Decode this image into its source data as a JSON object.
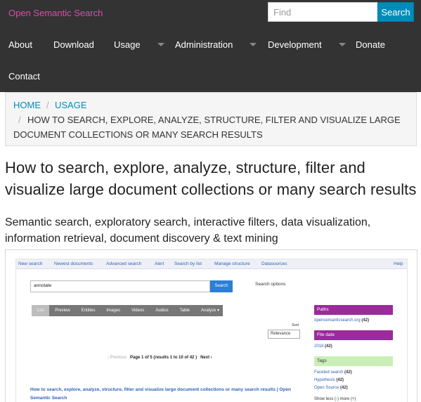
{
  "header": {
    "brand": "Open Semantic Search",
    "search_placeholder": "Find",
    "search_button": "Search"
  },
  "nav": {
    "items": [
      {
        "label": "About"
      },
      {
        "label": "Download"
      },
      {
        "label": "Usage",
        "dropdown": true
      },
      {
        "label": "Administration",
        "dropdown": true
      },
      {
        "label": "Development",
        "dropdown": true
      },
      {
        "label": "Donate"
      },
      {
        "label": "Contact"
      }
    ]
  },
  "breadcrumb": {
    "home": "Home",
    "usage": "Usage",
    "separator": "/",
    "current_line1": "How to search, explore, analyze, structure, filter and visualize large",
    "current_line2": "document collections or many search results"
  },
  "page": {
    "title": "How to search, explore, analyze, structure, filter and visualize large document collections or many search results",
    "subtitle": "Semantic search, exploratory search, interactive filters, data visualization, information retrieval, document discovery & text mining"
  },
  "screenshot": {
    "menu": [
      "New search",
      "Newest documents",
      "Advanced search",
      "Alert",
      "Search by list",
      "Manage structure",
      "Datasources",
      "Help"
    ],
    "query": "annotate",
    "search_button": "Search",
    "search_options": "Search options",
    "tabs": [
      "List",
      "Preview",
      "Entities",
      "Images",
      "Videos",
      "Audios",
      "Table",
      "Analyze ▾"
    ],
    "sort_label": "Sort",
    "sort_value": "Relevance",
    "pager_prev": "‹ Previous",
    "pager_status": "Page 1 of 5 (results 1 to 10 of 42 )",
    "pager_next": "Next ›",
    "result_title": "How to search, explore, analyze, structure, filter and visualize large document collections or many search results | Open Semantic Search",
    "facets": {
      "paths_title": "Paths",
      "paths_link": "opensemanticsearch.org",
      "paths_count": "(42)",
      "file_date_title": "File date",
      "file_date_link": "2018",
      "file_date_count": "(42)",
      "tags_title": "Tags",
      "tags": [
        {
          "label": "Faceted search",
          "count": "(42)"
        },
        {
          "label": "Hypothesis",
          "count": "(42)"
        },
        {
          "label": "Open Source",
          "count": "(42)"
        }
      ],
      "show_more": "Show less (-) more (+)"
    }
  },
  "colors": {
    "navbar": "#333333",
    "brand": "#d94ea8",
    "accent": "#008cba",
    "facet_purple": "#9b2a9b",
    "facet_green": "#c9efb7"
  }
}
